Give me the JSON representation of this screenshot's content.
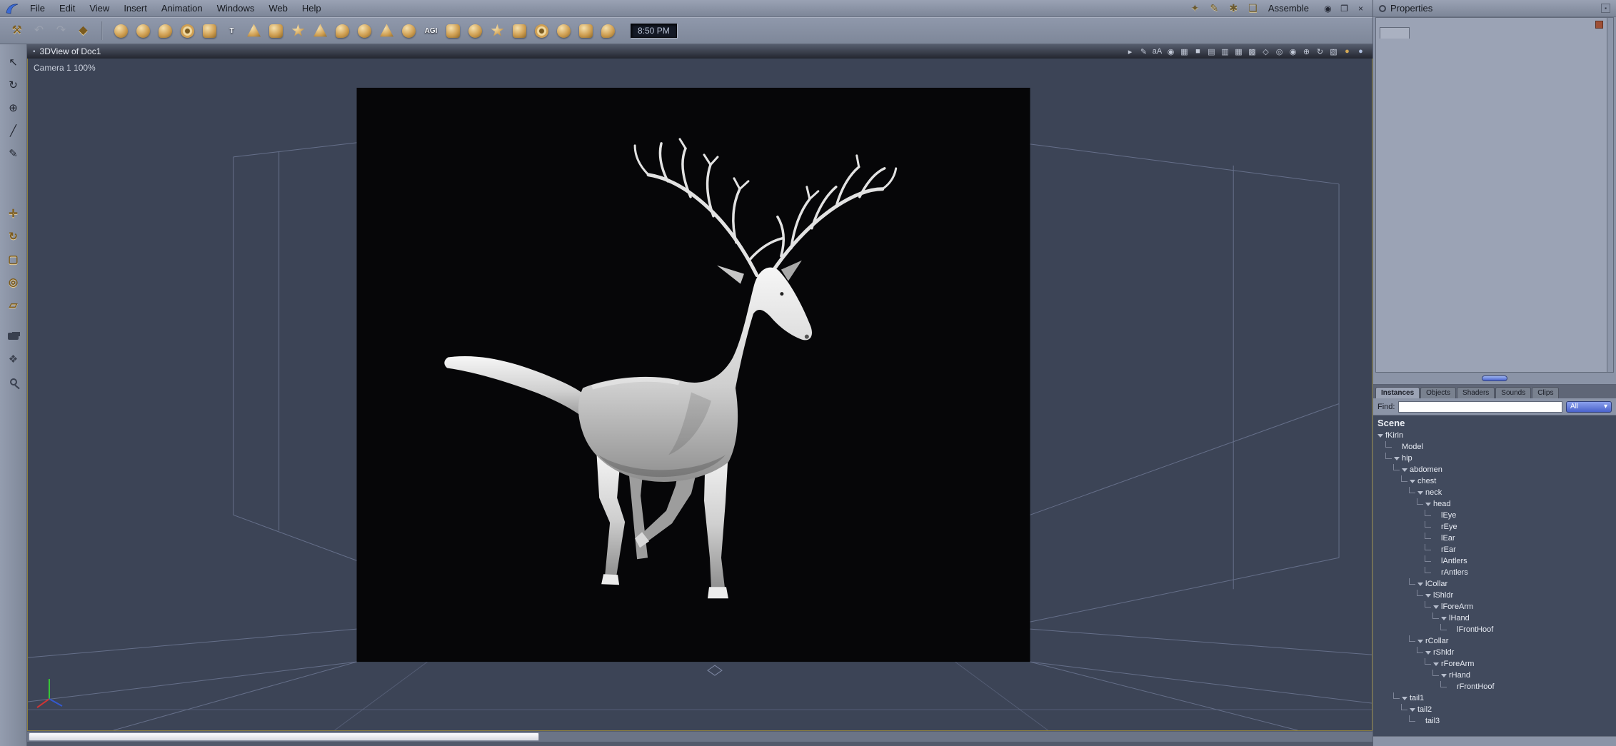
{
  "menubar": {
    "items": [
      "File",
      "Edit",
      "View",
      "Insert",
      "Animation",
      "Windows",
      "Web",
      "Help"
    ],
    "room_icons": [
      {
        "name": "assemble-room-icon",
        "glyph": "✦"
      },
      {
        "name": "model-room-icon",
        "glyph": "✎"
      },
      {
        "name": "texture-room-icon",
        "glyph": "✱"
      },
      {
        "name": "render-room-icon",
        "glyph": "❏"
      }
    ],
    "mode_label": "Assemble",
    "window_buttons": [
      {
        "name": "eye-icon",
        "glyph": "◉"
      },
      {
        "name": "restore-window-icon",
        "glyph": "❐"
      },
      {
        "name": "close-window-icon",
        "glyph": "×"
      }
    ]
  },
  "toolbar": {
    "file_tools": [
      {
        "name": "wrench-icon",
        "glyph": "⚒",
        "tone": "gold"
      },
      {
        "name": "undo-icon",
        "glyph": "↶",
        "tone": "gray"
      },
      {
        "name": "redo-icon",
        "glyph": "↷",
        "tone": "gray"
      },
      {
        "name": "finger-tool-icon",
        "glyph": "◆",
        "tone": "gold"
      }
    ],
    "insert_tools": [
      {
        "name": "sphere-tool-icon",
        "shape": "sphere"
      },
      {
        "name": "vertex-object-tool-icon",
        "shape": "sphere"
      },
      {
        "name": "spline-object-tool-icon",
        "shape": "drop"
      },
      {
        "name": "metaball-tool-icon",
        "shape": "torus"
      },
      {
        "name": "cube-tool-icon",
        "shape": "cube"
      },
      {
        "name": "text-tool-icon",
        "shape": "text",
        "glyph": "T"
      },
      {
        "name": "cone-tool-icon",
        "shape": "cone"
      },
      {
        "name": "polymesh-tool-icon",
        "shape": "cube"
      },
      {
        "name": "star-tool-icon",
        "shape": "star"
      },
      {
        "name": "terrain-tool-icon",
        "shape": "cone"
      },
      {
        "name": "plant-tool-icon",
        "shape": "drop"
      },
      {
        "name": "fountain-tool-icon",
        "shape": "sphere"
      },
      {
        "name": "fire-tool-icon",
        "shape": "cone"
      },
      {
        "name": "cloud-tool-icon",
        "shape": "sphere"
      },
      {
        "name": "agi-text-tool-icon",
        "shape": "text",
        "glyph": "AGI"
      },
      {
        "name": "ocean-tool-icon",
        "shape": "cube"
      },
      {
        "name": "rock-tool-icon",
        "shape": "sphere"
      },
      {
        "name": "light-tool-icon",
        "shape": "star"
      },
      {
        "name": "camera-tool-icon",
        "shape": "cube"
      },
      {
        "name": "particle-tool-icon",
        "shape": "torus"
      },
      {
        "name": "physics-tool-icon",
        "shape": "sphere"
      },
      {
        "name": "group-tool-icon",
        "shape": "cube"
      },
      {
        "name": "measure-tool-icon",
        "shape": "drop"
      }
    ],
    "time": "8:50 PM"
  },
  "left_toolbar": {
    "select_tools": [
      {
        "name": "pointer-tool-icon",
        "glyph": "↖"
      },
      {
        "name": "rotate-view-tool-icon",
        "glyph": "↻"
      },
      {
        "name": "universal-manipulator-icon",
        "glyph": "⊕"
      },
      {
        "name": "scalpel-tool-icon",
        "glyph": "╱"
      },
      {
        "name": "paintbrush-tool-icon",
        "glyph": "✎"
      }
    ],
    "transform_tools": [
      {
        "name": "move-tool-icon",
        "glyph": "✛"
      },
      {
        "name": "rotate-tool-icon",
        "glyph": "↻"
      },
      {
        "name": "scale-tool-icon",
        "glyph": "▢"
      },
      {
        "name": "hotpoint-tool-icon",
        "glyph": "◎"
      },
      {
        "name": "shear-tool-icon",
        "glyph": "▱"
      }
    ],
    "view_tools": [
      {
        "name": "dolly-camera-icon",
        "kind": "cam"
      },
      {
        "name": "pan-hand-icon",
        "glyph": "❖"
      },
      {
        "name": "zoom-tool-icon",
        "kind": "mag"
      }
    ]
  },
  "viewport": {
    "title": "3DView of Doc1",
    "title_icon_glyph": "▪",
    "camera_label": "Camera 1 100%",
    "display_icons": [
      {
        "name": "marker-icon",
        "glyph": "▸"
      },
      {
        "name": "edit-display-icon",
        "glyph": "✎"
      },
      {
        "name": "antialias-icon",
        "glyph": "aA"
      },
      {
        "name": "quality-sphere-icon",
        "glyph": "◉"
      },
      {
        "name": "grid-toggle-icon",
        "glyph": "▦"
      },
      {
        "name": "single-pane-icon",
        "glyph": "■"
      },
      {
        "name": "split-horizontal-icon",
        "glyph": "▤"
      },
      {
        "name": "split-vertical-icon",
        "glyph": "▥"
      },
      {
        "name": "quad-pane-icon",
        "glyph": "▦"
      },
      {
        "name": "full-grid-pane-icon",
        "glyph": "▩"
      },
      {
        "name": "wireframe-mode-icon",
        "glyph": "◇"
      },
      {
        "name": "shaded-mode-icon",
        "glyph": "◎"
      },
      {
        "name": "textured-mode-icon",
        "glyph": "◉"
      },
      {
        "name": "camera-target-icon",
        "glyph": "⊕"
      },
      {
        "name": "rotate-display-icon",
        "glyph": "↻"
      },
      {
        "name": "production-frame-icon",
        "glyph": "▧"
      },
      {
        "name": "gold-sphere-icon",
        "glyph": "●",
        "color": "#d2a855"
      },
      {
        "name": "silver-sphere-icon",
        "glyph": "●",
        "color": "#aebedd"
      }
    ]
  },
  "properties": {
    "title": "Properties",
    "options_glyph": "▪"
  },
  "browser": {
    "tabs": [
      {
        "label": "Instances",
        "active": true
      },
      {
        "label": "Objects",
        "active": false
      },
      {
        "label": "Shaders",
        "active": false
      },
      {
        "label": "Sounds",
        "active": false
      },
      {
        "label": "Clips",
        "active": false
      }
    ],
    "find_label": "Find:",
    "find_value": "",
    "filter_value": "All",
    "filter_arrow": "▾",
    "scene_label": "Scene",
    "tree": [
      {
        "label": "fKirin",
        "depth": 0,
        "children": true
      },
      {
        "label": "Model",
        "depth": 1,
        "children": false
      },
      {
        "label": "hip",
        "depth": 1,
        "children": true
      },
      {
        "label": "abdomen",
        "depth": 2,
        "children": true
      },
      {
        "label": "chest",
        "depth": 3,
        "children": true
      },
      {
        "label": "neck",
        "depth": 4,
        "children": true
      },
      {
        "label": "head",
        "depth": 5,
        "children": true
      },
      {
        "label": "lEye",
        "depth": 6,
        "children": false
      },
      {
        "label": "rEye",
        "depth": 6,
        "children": false
      },
      {
        "label": "lEar",
        "depth": 6,
        "children": false
      },
      {
        "label": "rEar",
        "depth": 6,
        "children": false
      },
      {
        "label": "lAntlers",
        "depth": 6,
        "children": false
      },
      {
        "label": "rAntlers",
        "depth": 6,
        "children": false
      },
      {
        "label": "lCollar",
        "depth": 4,
        "children": true
      },
      {
        "label": "lShldr",
        "depth": 5,
        "children": true
      },
      {
        "label": "lForeArm",
        "depth": 6,
        "children": true
      },
      {
        "label": "lHand",
        "depth": 7,
        "children": true
      },
      {
        "label": "lFrontHoof",
        "depth": 8,
        "children": false
      },
      {
        "label": "rCollar",
        "depth": 4,
        "children": true
      },
      {
        "label": "rShldr",
        "depth": 5,
        "children": true
      },
      {
        "label": "rForeArm",
        "depth": 6,
        "children": true
      },
      {
        "label": "rHand",
        "depth": 7,
        "children": true
      },
      {
        "label": "rFrontHoof",
        "depth": 8,
        "children": false
      },
      {
        "label": "tail1",
        "depth": 2,
        "children": true
      },
      {
        "label": "tail2",
        "depth": 3,
        "children": true
      },
      {
        "label": "tail3",
        "depth": 4,
        "children": false
      }
    ]
  }
}
